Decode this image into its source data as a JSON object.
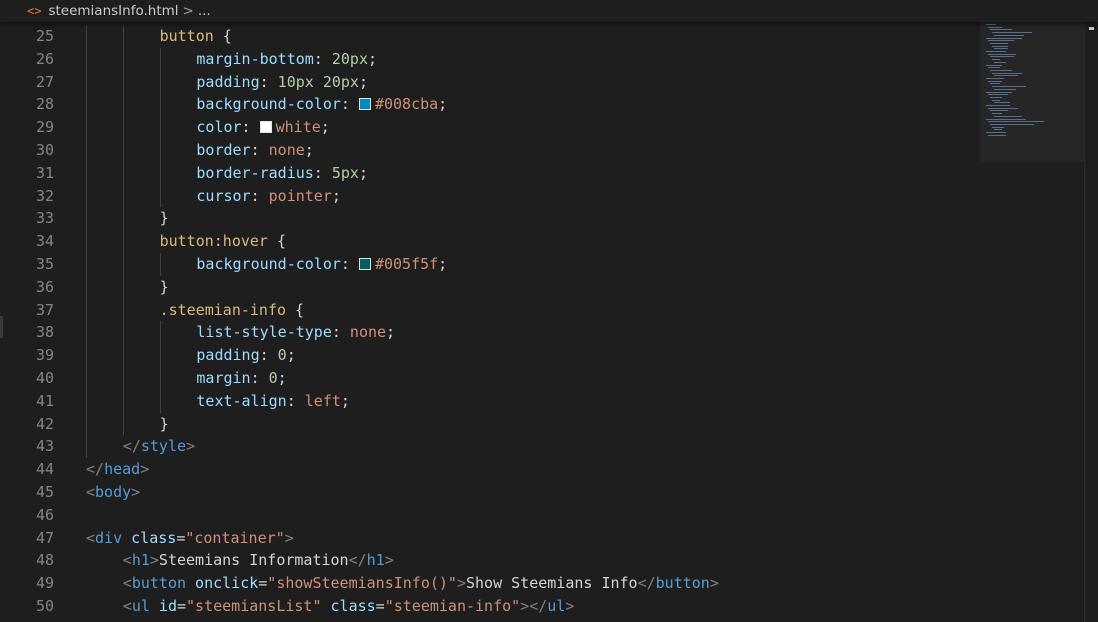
{
  "breadcrumb": {
    "icon": "html-file-icon",
    "file": "steemiansInfo.html",
    "separator": ">",
    "more": "..."
  },
  "colors": {
    "background": "#1e1e1e",
    "swatch_1": "#008cba",
    "swatch_2": "#ffffff",
    "swatch_3": "#005f5f"
  },
  "lines": [
    {
      "n": "25",
      "indent": 2,
      "tokens": [
        [
          "sel",
          "button"
        ],
        [
          "pun",
          " {"
        ]
      ]
    },
    {
      "n": "26",
      "indent": 3,
      "tokens": [
        [
          "prop",
          "margin-bottom"
        ],
        [
          "pun",
          ": "
        ],
        [
          "num",
          "20px"
        ],
        [
          "pun",
          ";"
        ]
      ]
    },
    {
      "n": "27",
      "indent": 3,
      "tokens": [
        [
          "prop",
          "padding"
        ],
        [
          "pun",
          ": "
        ],
        [
          "num",
          "10px 20px"
        ],
        [
          "pun",
          ";"
        ]
      ]
    },
    {
      "n": "28",
      "indent": 3,
      "tokens": [
        [
          "prop",
          "background-color"
        ],
        [
          "pun",
          ": "
        ],
        [
          "swatch",
          "#008cba"
        ],
        [
          "val",
          "#008cba"
        ],
        [
          "pun",
          ";"
        ]
      ]
    },
    {
      "n": "29",
      "indent": 3,
      "tokens": [
        [
          "prop",
          "color"
        ],
        [
          "pun",
          ": "
        ],
        [
          "swatch",
          "#ffffff"
        ],
        [
          "val",
          "white"
        ],
        [
          "pun",
          ";"
        ]
      ]
    },
    {
      "n": "30",
      "indent": 3,
      "tokens": [
        [
          "prop",
          "border"
        ],
        [
          "pun",
          ": "
        ],
        [
          "val",
          "none"
        ],
        [
          "pun",
          ";"
        ]
      ]
    },
    {
      "n": "31",
      "indent": 3,
      "tokens": [
        [
          "prop",
          "border-radius"
        ],
        [
          "pun",
          ": "
        ],
        [
          "num",
          "5px"
        ],
        [
          "pun",
          ";"
        ]
      ]
    },
    {
      "n": "32",
      "indent": 3,
      "tokens": [
        [
          "prop",
          "cursor"
        ],
        [
          "pun",
          ": "
        ],
        [
          "val",
          "pointer"
        ],
        [
          "pun",
          ";"
        ]
      ]
    },
    {
      "n": "33",
      "indent": 2,
      "tokens": [
        [
          "pun",
          "}"
        ]
      ]
    },
    {
      "n": "34",
      "indent": 2,
      "tokens": [
        [
          "sel",
          "button:hover"
        ],
        [
          "pun",
          " {"
        ]
      ]
    },
    {
      "n": "35",
      "indent": 3,
      "tokens": [
        [
          "prop",
          "background-color"
        ],
        [
          "pun",
          ": "
        ],
        [
          "swatch",
          "#005f5f"
        ],
        [
          "val",
          "#005f5f"
        ],
        [
          "pun",
          ";"
        ]
      ]
    },
    {
      "n": "36",
      "indent": 2,
      "tokens": [
        [
          "pun",
          "}"
        ]
      ]
    },
    {
      "n": "37",
      "indent": 2,
      "tokens": [
        [
          "sel",
          ".steemian-info"
        ],
        [
          "pun",
          " {"
        ]
      ]
    },
    {
      "n": "38",
      "indent": 3,
      "tokens": [
        [
          "prop",
          "list-style-type"
        ],
        [
          "pun",
          ": "
        ],
        [
          "val",
          "none"
        ],
        [
          "pun",
          ";"
        ]
      ]
    },
    {
      "n": "39",
      "indent": 3,
      "tokens": [
        [
          "prop",
          "padding"
        ],
        [
          "pun",
          ": "
        ],
        [
          "num",
          "0"
        ],
        [
          "pun",
          ";"
        ]
      ]
    },
    {
      "n": "40",
      "indent": 3,
      "tokens": [
        [
          "prop",
          "margin"
        ],
        [
          "pun",
          ": "
        ],
        [
          "num",
          "0"
        ],
        [
          "pun",
          ";"
        ]
      ]
    },
    {
      "n": "41",
      "indent": 3,
      "tokens": [
        [
          "prop",
          "text-align"
        ],
        [
          "pun",
          ": "
        ],
        [
          "val",
          "left"
        ],
        [
          "pun",
          ";"
        ]
      ]
    },
    {
      "n": "42",
      "indent": 2,
      "tokens": [
        [
          "pun",
          "}"
        ]
      ]
    },
    {
      "n": "43",
      "indent": 1,
      "tokens": [
        [
          "br",
          "</"
        ],
        [
          "tag",
          "style"
        ],
        [
          "br",
          ">"
        ]
      ]
    },
    {
      "n": "44",
      "indent": 0,
      "tokens": [
        [
          "br",
          "</"
        ],
        [
          "tag",
          "head"
        ],
        [
          "br",
          ">"
        ]
      ]
    },
    {
      "n": "45",
      "indent": 0,
      "tokens": [
        [
          "br",
          "<"
        ],
        [
          "tag",
          "body"
        ],
        [
          "br",
          ">"
        ]
      ]
    },
    {
      "n": "46",
      "indent": 0,
      "tokens": []
    },
    {
      "n": "47",
      "indent": 0,
      "tokens": [
        [
          "br",
          "<"
        ],
        [
          "tag",
          "div"
        ],
        [
          "txt",
          " "
        ],
        [
          "attr",
          "class"
        ],
        [
          "pun",
          "="
        ],
        [
          "str",
          "\"container\""
        ],
        [
          "br",
          ">"
        ]
      ]
    },
    {
      "n": "48",
      "indent": 1,
      "tokens": [
        [
          "br",
          "<"
        ],
        [
          "tag",
          "h1"
        ],
        [
          "br",
          ">"
        ],
        [
          "txt",
          "Steemians Information"
        ],
        [
          "br",
          "</"
        ],
        [
          "tag",
          "h1"
        ],
        [
          "br",
          ">"
        ]
      ]
    },
    {
      "n": "49",
      "indent": 1,
      "tokens": [
        [
          "br",
          "<"
        ],
        [
          "tag",
          "button"
        ],
        [
          "txt",
          " "
        ],
        [
          "attr",
          "onclick"
        ],
        [
          "pun",
          "="
        ],
        [
          "str",
          "\"showSteemiansInfo()\""
        ],
        [
          "br",
          ">"
        ],
        [
          "txt",
          "Show Steemians Info"
        ],
        [
          "br",
          "</"
        ],
        [
          "tag",
          "button"
        ],
        [
          "br",
          ">"
        ]
      ]
    },
    {
      "n": "50",
      "indent": 1,
      "tokens": [
        [
          "br",
          "<"
        ],
        [
          "tag",
          "ul"
        ],
        [
          "txt",
          " "
        ],
        [
          "attr",
          "id"
        ],
        [
          "pun",
          "="
        ],
        [
          "str",
          "\"steemiansList\""
        ],
        [
          "txt",
          " "
        ],
        [
          "attr",
          "class"
        ],
        [
          "pun",
          "="
        ],
        [
          "str",
          "\"steemian-info\""
        ],
        [
          "br",
          "></"
        ],
        [
          "tag",
          "ul"
        ],
        [
          "br",
          ">"
        ]
      ]
    }
  ]
}
